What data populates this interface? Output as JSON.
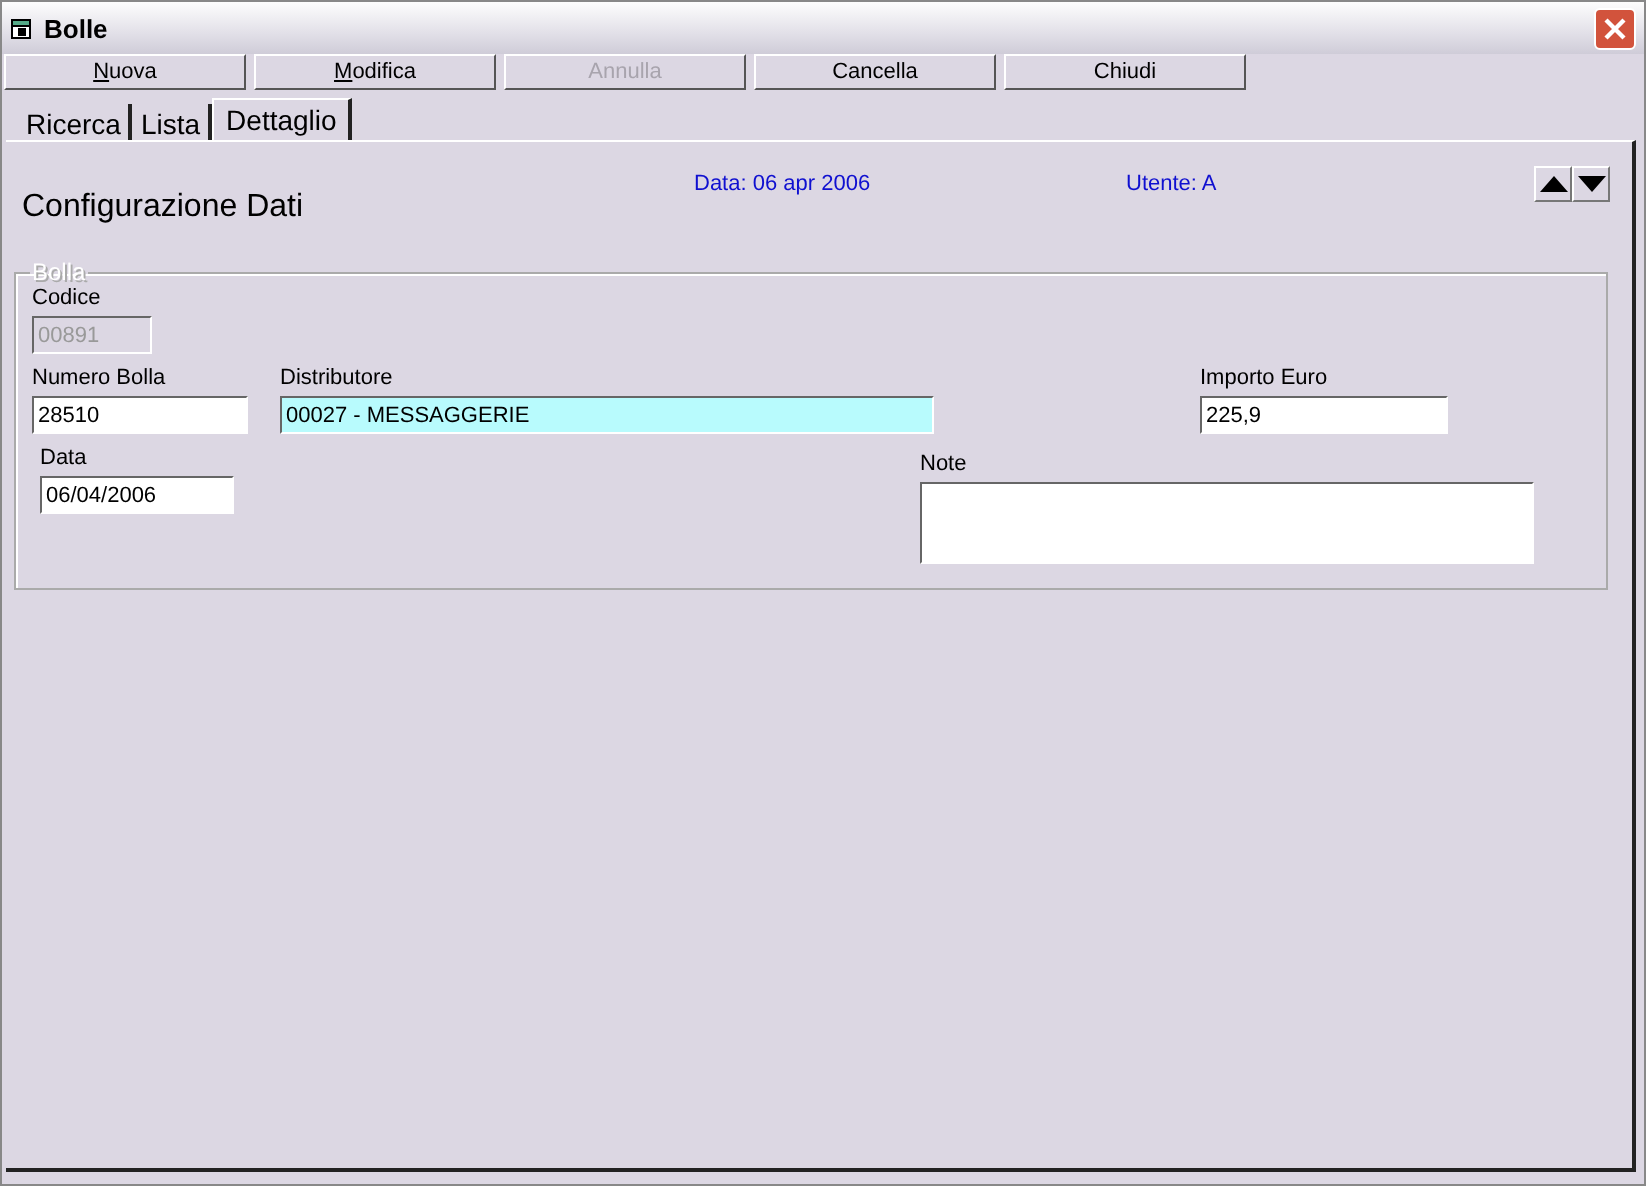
{
  "window": {
    "title": "Bolle"
  },
  "toolbar": [
    {
      "label": "Nuova",
      "mnemonic": true,
      "disabled": false
    },
    {
      "label": "Modifica",
      "mnemonic": true,
      "disabled": false
    },
    {
      "label": "Annulla",
      "mnemonic": false,
      "disabled": true
    },
    {
      "label": "Cancella",
      "mnemonic": false,
      "disabled": false
    },
    {
      "label": "Chiudi",
      "mnemonic": false,
      "disabled": false
    }
  ],
  "tabs": [
    {
      "label": "Ricerca",
      "selected": false
    },
    {
      "label": "Lista",
      "selected": false
    },
    {
      "label": "Dettaglio",
      "selected": true
    }
  ],
  "header": {
    "title": "Configurazione Dati",
    "date": "Data: 06 apr 2006",
    "user": "Utente: A"
  },
  "group": {
    "legend": "Bolla",
    "disabled": true,
    "codice": {
      "label": "Codice",
      "value": "00891",
      "disabled": true
    },
    "numero": {
      "label": "Numero Bolla",
      "value": "28510"
    },
    "distributore": {
      "label": "Distributore",
      "value": "00027 - MESSAGGERIE",
      "highlighted": true
    },
    "importo": {
      "label": "Importo Euro",
      "value": "225,9"
    },
    "data": {
      "label": "Data",
      "value": "06/04/2006"
    },
    "note": {
      "label": "Note"
    }
  }
}
